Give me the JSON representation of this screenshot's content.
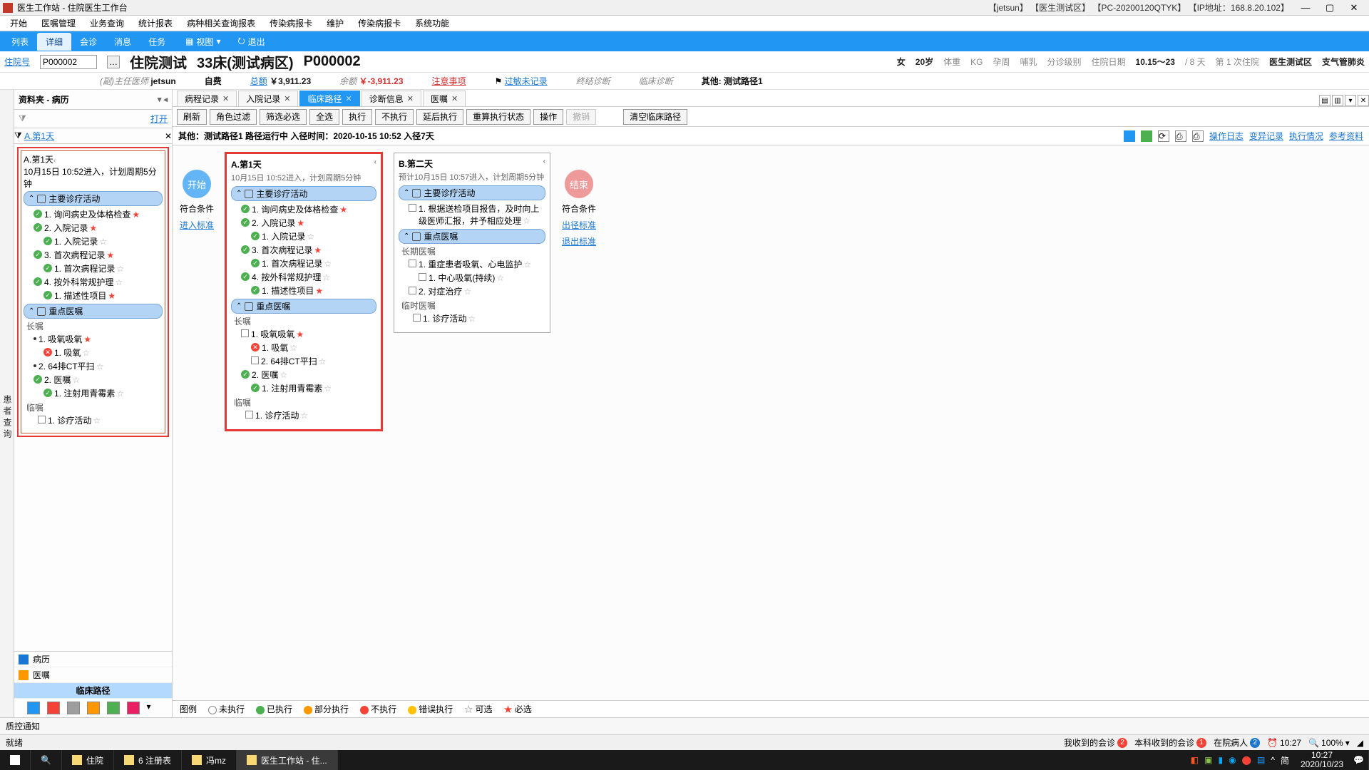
{
  "titlebar": {
    "title": "医生工作站 - 住院医生工作台",
    "info": "【jetsun】 【医生测试区】 【PC-20200120QTYK】 【IP地址：168.8.20.102】"
  },
  "menubar": [
    "开始",
    "医嘱管理",
    "业务查询",
    "统计报表",
    "病种相关查询报表",
    "传染病报卡",
    "维护",
    "传染病报卡",
    "系统功能"
  ],
  "ribbon": {
    "tabs": [
      "列表",
      "详细",
      "会诊",
      "消息",
      "任务"
    ],
    "active": 1,
    "view": "视图",
    "exit": "退出"
  },
  "patient": {
    "field_label": "住院号",
    "field_val": "P000002",
    "name": "住院测试",
    "bed": "33床(测试病区)",
    "pid": "P000002",
    "sex": "女",
    "age": "20岁",
    "wt_l": "体重",
    "wt_u": "KG",
    "preg": "孕周",
    "feed": "哺乳",
    "tri": "分诊级别",
    "dd_l": "住院日期",
    "dd_v": "10.15～23",
    "days": "/ 8 天",
    "times": "第 1 次住院",
    "dept": "医生测试区",
    "diag": "支气管肺炎"
  },
  "detail": {
    "doc_l": "(副)主任医师",
    "doc_v": "jetsun",
    "pay": "自费",
    "tot_l": "总额",
    "tot_v": "￥3,911.23",
    "bal_l": "余额",
    "bal_v": "￥-3,911.23",
    "caution": "注意事项",
    "allergy": "过敏未记录",
    "final": "终结诊断",
    "cldiag": "临床诊断",
    "other_l": "其他:",
    "other_v": "测试路径1"
  },
  "side": "患者查询",
  "left": {
    "head": "资料夹 - 病历",
    "open": "打开",
    "tab": "A.第1天",
    "card": {
      "title": "A.第1天",
      "sub": "10月15日 10:52进入，计划周期5分钟",
      "s1": "主要诊疗活动",
      "s1n": [
        {
          "t": "1. 询问病史及体格检查",
          "s": "ok",
          "star": 1
        },
        {
          "t": "2. 入院记录",
          "s": "ok",
          "star": 1
        },
        {
          "t": "1. 入院记录",
          "s": "ok",
          "star": 0,
          "i": 1
        },
        {
          "t": "3. 首次病程记录",
          "s": "ok",
          "star": 1
        },
        {
          "t": "1. 首次病程记录",
          "s": "ok",
          "star": 0,
          "i": 1
        },
        {
          "t": "4. 按外科常规护理",
          "s": "ok",
          "star": 0
        },
        {
          "t": "1. 描述性项目",
          "s": "ok",
          "star": 1,
          "i": 1
        }
      ],
      "s2": "重点医嘱",
      "long": "长嘱",
      "s2n": [
        {
          "t": "1. 吸氧吸氧",
          "star": 1,
          "b": 1
        },
        {
          "t": "1. 吸氧",
          "s": "no",
          "star": 0,
          "i": 1
        },
        {
          "t": "2. 64排CT平扫",
          "star": 0,
          "b": 1
        },
        {
          "t": "2. 医嘱",
          "s": "ok",
          "star": 0
        },
        {
          "t": "1. 注射用青霉素",
          "s": "ok",
          "star": 0,
          "i": 1
        }
      ],
      "temp": "临嘱",
      "tn": "1. 诊疗活动"
    },
    "nav": [
      {
        "t": "病历",
        "c": "#1976d2"
      },
      {
        "t": "医嘱",
        "c": "#ff9800"
      },
      {
        "t": "临床路径",
        "sel": 1
      }
    ]
  },
  "doctabs": [
    {
      "t": "病程记录",
      "x": 1
    },
    {
      "t": "入院记录",
      "x": 1
    },
    {
      "t": "临床路径",
      "x": 1,
      "a": 1
    },
    {
      "t": "诊断信息",
      "x": 1
    },
    {
      "t": "医嘱",
      "x": 1
    }
  ],
  "toolbar": [
    "刷新",
    "角色过滤",
    "筛选必选",
    "全选",
    "执行",
    "不执行",
    "延后执行",
    "重算执行状态",
    "操作"
  ],
  "toolbar_dis": "撤销",
  "toolbar_clear": "清空临床路径",
  "infoline": "其他：测试路径1  路径运行中 入径时间：2020-10-15 10:52 入径7天",
  "info_links": [
    "操作日志",
    "变异记录",
    "执行情况",
    "参考资料"
  ],
  "start": {
    "btn": "开始",
    "cond": "符合条件",
    "link": "进入标准"
  },
  "end": {
    "btn": "结束",
    "cond": "符合条件",
    "l1": "出径标准",
    "l2": "退出标准"
  },
  "dayA": {
    "title": "A.第1天",
    "sub": "10月15日 10:52进入，计划周期5分钟",
    "s1": "主要诊疗活动",
    "s2": "重点医嘱",
    "long": "长嘱",
    "temp": "临嘱",
    "s1n": [
      {
        "t": "1. 询问病史及体格检查",
        "s": "ok",
        "star": 1
      },
      {
        "t": "2. 入院记录",
        "s": "ok",
        "star": 1
      },
      {
        "t": "1. 入院记录",
        "s": "ok",
        "star": 0,
        "i": 1
      },
      {
        "t": "3. 首次病程记录",
        "s": "ok",
        "star": 1
      },
      {
        "t": "1. 首次病程记录",
        "s": "ok",
        "star": 0,
        "i": 1
      },
      {
        "t": "4. 按外科常规护理",
        "s": "ok",
        "star": 0
      },
      {
        "t": "1. 描述性项目",
        "s": "ok",
        "star": 1,
        "i": 1
      }
    ],
    "s2n": [
      {
        "t": "1. 吸氧吸氧",
        "star": 1,
        "b": 1,
        "cb": 1
      },
      {
        "t": "1. 吸氧",
        "s": "no",
        "star": 0,
        "i": 1
      },
      {
        "t": "2. 64排CT平扫",
        "star": 0,
        "b": 1,
        "cb": 1,
        "i": 1
      },
      {
        "t": "2. 医嘱",
        "s": "ok",
        "star": 0
      },
      {
        "t": "1. 注射用青霉素",
        "s": "ok",
        "star": 0,
        "i": 1
      }
    ],
    "tn": "1. 诊疗活动"
  },
  "dayB": {
    "title": "B.第二天",
    "sub": "预计10月15日 10:57进入，计划周期5分钟",
    "s1": "主要诊疗活动",
    "s2": "重点医嘱",
    "long": "长期医嘱",
    "temp": "临时医嘱",
    "s1n": [
      {
        "t": "1. 根据送检项目报告，及时向上级医师汇报，并予相应处理",
        "cb": 1
      }
    ],
    "s2n": [
      {
        "t": "1. 重症患者吸氧、心电监护",
        "cb": 1,
        "b": 1,
        "star": 0
      },
      {
        "t": "1. 中心吸氧(持续)",
        "cb": 1,
        "i": 1,
        "star": 0
      },
      {
        "t": "2. 对症治疗",
        "cb": 1,
        "b": 1,
        "star": 0
      }
    ],
    "tn": "1. 诊疗活动"
  },
  "legend": {
    "l": "图例",
    "items": [
      {
        "t": "未执行",
        "c": "#fff",
        "b": "#888"
      },
      {
        "t": "已执行",
        "c": "#4caf50"
      },
      {
        "t": "部分执行",
        "c": "#ff9800"
      },
      {
        "t": "不执行",
        "c": "#f44336"
      },
      {
        "t": "错误执行",
        "c": "#ffc107"
      },
      {
        "t": "可选",
        "pre": "☆"
      },
      {
        "t": "必选",
        "pre": "★",
        "pc": "#f44336"
      }
    ]
  },
  "qc": "质控通知",
  "status": {
    "ready": "就绪",
    "i1": "我收到的会诊",
    "b1": "2",
    "i2": "本科收到的会诊",
    "b2": "1",
    "i3": "在院病人",
    "b3": "2",
    "time": "10:27",
    "zoom": "100%"
  },
  "taskbar": {
    "items": [
      "住院",
      "6  注册表",
      "冯mz",
      "医生工作站 - 住..."
    ],
    "clock1": "10:27",
    "clock2": "2020/10/23",
    "ime": "简"
  }
}
